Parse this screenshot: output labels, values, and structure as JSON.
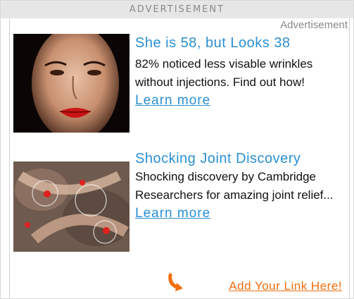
{
  "header": {
    "label": "ADVERTISEMENT"
  },
  "ad_label": "Advertisement",
  "ads": [
    {
      "title": "She is 58, but Looks 38",
      "description": "82% noticed less visable wrinkles without injections. Find out how!",
      "link_label": "Learn more",
      "image": "woman-face-photo"
    },
    {
      "title": "Shocking Joint Discovery",
      "description": "Shocking discovery by Cambridge Researchers for amazing joint relief...",
      "link_label": "Learn more",
      "image": "joint-anatomy-photo"
    }
  ],
  "footer": {
    "add_link_label": "Add Your Link Here!",
    "icon": "curved-arrow-icon"
  },
  "colors": {
    "link": "#2a8fd4",
    "accent": "#f26d0d",
    "bar": "#e6e6e6"
  }
}
